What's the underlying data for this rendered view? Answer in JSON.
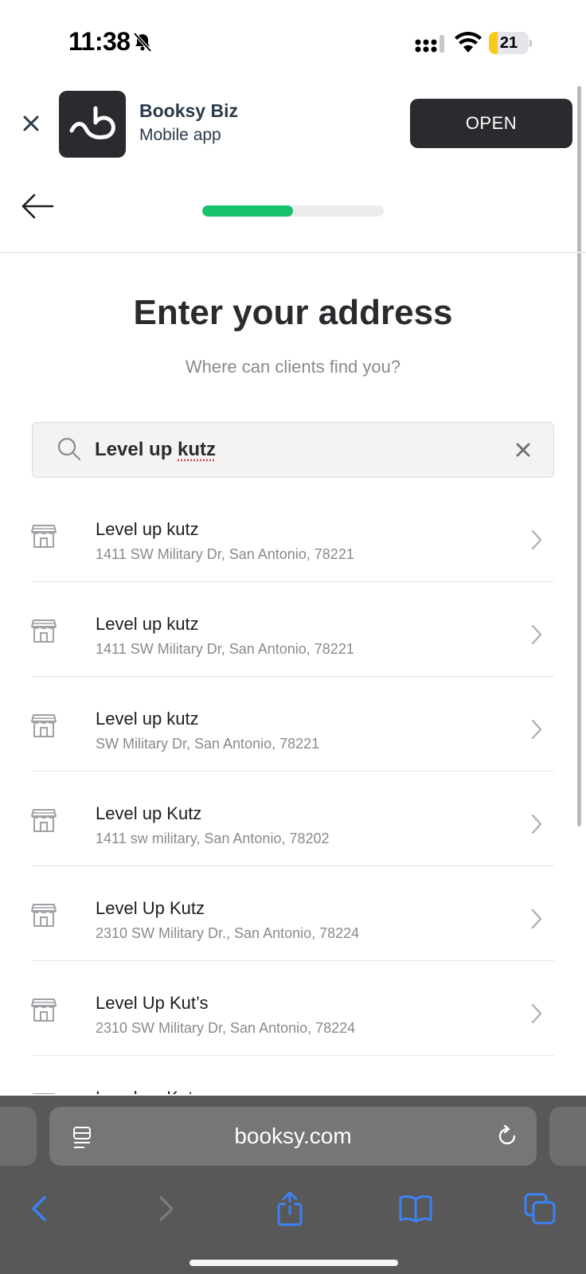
{
  "status_bar": {
    "time": "11:38",
    "battery_level": "21",
    "battery_fraction": 0.21
  },
  "banner": {
    "app_name": "Booksy Biz",
    "app_subtitle": "Mobile app",
    "open_label": "OPEN"
  },
  "progress": {
    "fraction": 0.5
  },
  "page": {
    "title": "Enter your address",
    "subtitle": "Where can clients find you?"
  },
  "search": {
    "value_part1": "Level up ",
    "value_part2": "kutz"
  },
  "results": [
    {
      "name": "Level up kutz",
      "address": "1411 SW Military Dr, San Antonio, 78221"
    },
    {
      "name": "Level up kutz",
      "address": "1411 SW Military Dr, San Antonio, 78221"
    },
    {
      "name": "Level up kutz",
      "address": "SW Military Dr, San Antonio, 78221"
    },
    {
      "name": "Level up Kutz",
      "address": "1411 sw military, San Antonio, 78202"
    },
    {
      "name": "Level Up Kutz",
      "address": "2310 SW Military Dr., San Antonio, 78224"
    },
    {
      "name": "Level Up Kut’s",
      "address": "2310 SW Military Dr, San Antonio, 78224"
    },
    {
      "name": "Level up Kutz",
      "address": ""
    }
  ],
  "browser": {
    "url": "booksy.com"
  },
  "colors": {
    "accent_green": "#17c26c",
    "dark": "#2a2b2e",
    "safari_blue": "#3b82f6"
  },
  "icons": {
    "bell": "bell-slash-icon",
    "store": "storefront-icon",
    "search": "magnifier-icon",
    "clear": "x-icon",
    "back": "arrow-left-icon",
    "reader": "reader-icon",
    "reload": "reload-icon"
  }
}
